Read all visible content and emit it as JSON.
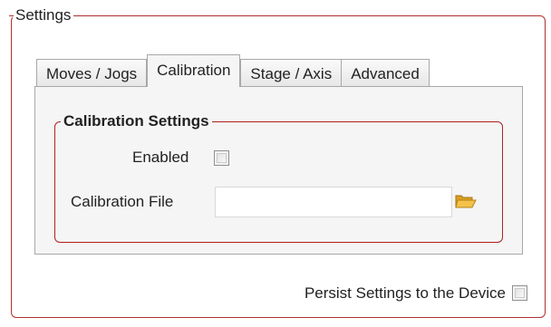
{
  "settings_group": {
    "title": "Settings"
  },
  "tabs": [
    {
      "label": "Moves / Jogs",
      "selected": false
    },
    {
      "label": "Calibration",
      "selected": true
    },
    {
      "label": "Stage / Axis",
      "selected": false
    },
    {
      "label": "Advanced",
      "selected": false
    }
  ],
  "calibration": {
    "group_title": "Calibration Settings",
    "enabled_label": "Enabled",
    "enabled_checked": false,
    "file_label": "Calibration File",
    "file_value": "",
    "browse_icon": "open-folder-icon"
  },
  "persist": {
    "label": "Persist Settings to the Device",
    "checked": false
  },
  "colors": {
    "group_border": "#b03030",
    "tab_border": "#a8a8a8",
    "panel_background": "#f5f5f5",
    "folder_icon": "#e8b030"
  }
}
